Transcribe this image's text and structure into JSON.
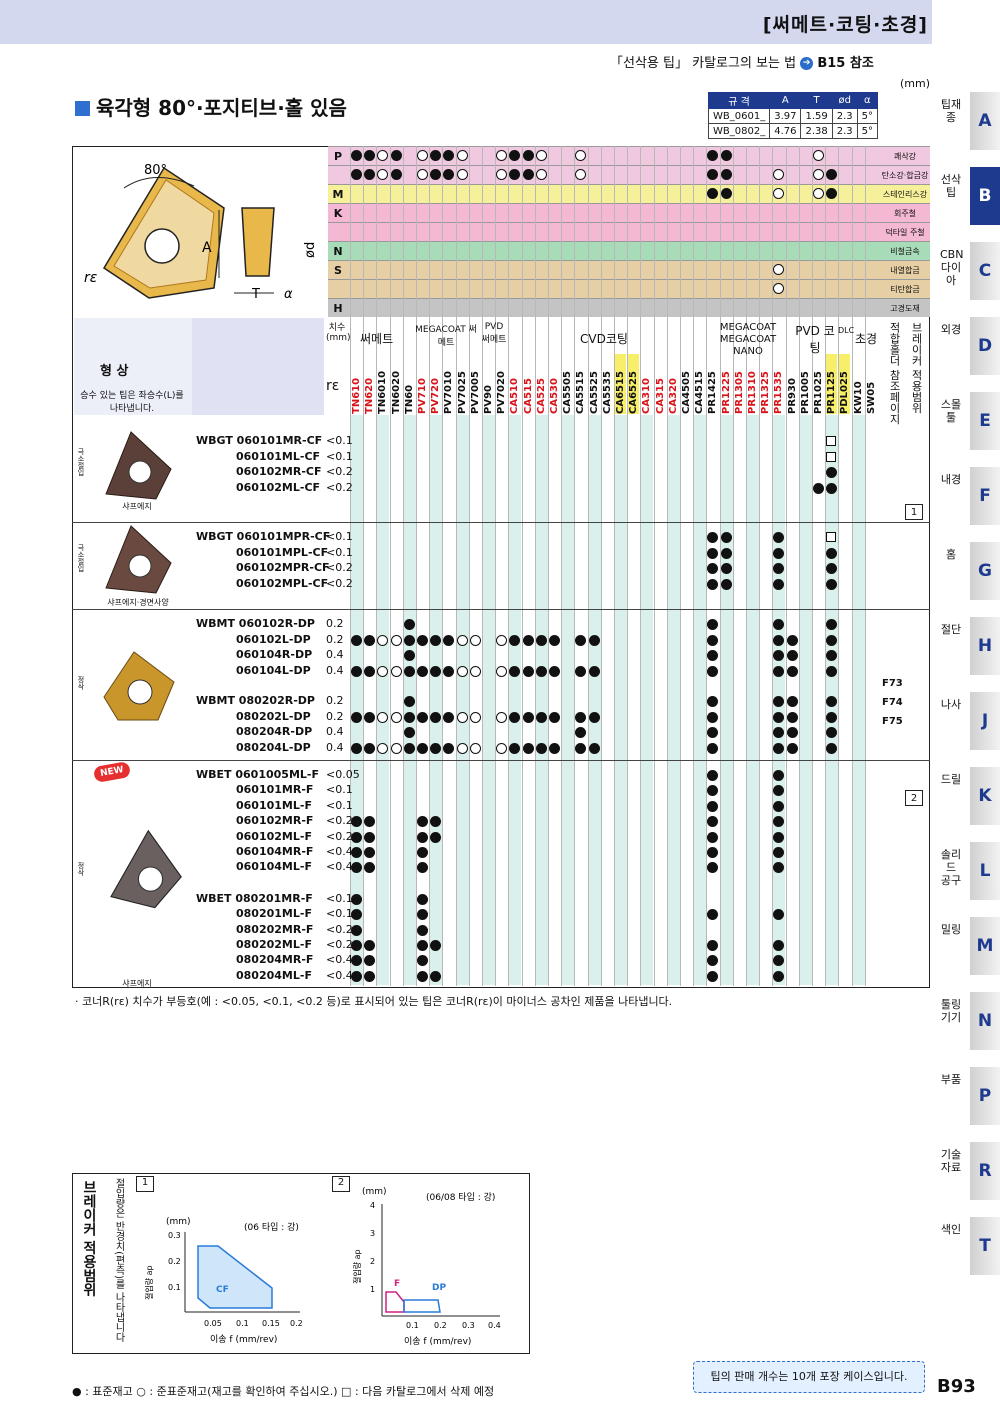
{
  "header": {
    "title": "[써메트·코팅·초경]"
  },
  "reference": {
    "text": "「선삭용 팁」 카탈로그의 보는 법",
    "link": "B15 참조"
  },
  "unit": "(mm)",
  "section_title": "육각형 80°·포지티브·홀 있음",
  "dim_table": {
    "headers": [
      "규 격",
      "A",
      "T",
      "ød",
      "α"
    ],
    "rows": [
      [
        "WB_0601_",
        "3.97",
        "1.59",
        "2.3",
        "5°"
      ],
      [
        "WB_0802_",
        "4.76",
        "2.38",
        "2.3",
        "5°"
      ]
    ]
  },
  "diagram": {
    "angle": "80°",
    "a": "A",
    "t": "T",
    "d": "ød",
    "alpha": "α",
    "re": "rε"
  },
  "work_materials": [
    {
      "code": "P",
      "name": "쾌삭강",
      "color": "#f0c8e0"
    },
    {
      "code": "",
      "name": "탄소강·합금강",
      "color": "#f0c8e0"
    },
    {
      "code": "M",
      "name": "스테인리스강",
      "color": "#f6f09a"
    },
    {
      "code": "K",
      "name": "회주철",
      "color": "#f4b8d4"
    },
    {
      "code": "",
      "name": "덕타일 주철",
      "color": "#f4b8d4"
    },
    {
      "code": "N",
      "name": "비철금속",
      "color": "#a8dcb8"
    },
    {
      "code": "S",
      "name": "내열합금",
      "color": "#e6cfa4"
    },
    {
      "code": "",
      "name": "티탄합금",
      "color": "#e6cfa4"
    },
    {
      "code": "H",
      "name": "고경도재",
      "color": "#c4c4c4"
    }
  ],
  "col_groups": {
    "size": "치수 (mm)",
    "cermet": "써메트",
    "megacoat_cermet": "MEGACOAT 써메트",
    "pvd_cermet": "PVD 써메트",
    "cvd": "CVD코팅",
    "megacoat_nano": "MEGACOAT MEGACOAT NANO",
    "pvd": "PVD 코팅",
    "dlc": "DLC",
    "carbide": "초경",
    "holder": "적합홀더 참조페이지",
    "breaker": "브레이커 적용범위"
  },
  "shape_head": "형 상",
  "spec_head": "규 격",
  "shape_note": "승수 있는 팁은 좌승수(L)를 나타냅니다.",
  "re_head": "rε",
  "grades": [
    "TN610",
    "TN620",
    "TN6010",
    "TN6020",
    "TN60",
    "PV710",
    "PV720",
    "PV7010",
    "PV7025",
    "PV7005",
    "PV90",
    "PV7020",
    "CA510",
    "CA515",
    "CA525",
    "CA530",
    "CA5505",
    "CA5515",
    "CA5525",
    "CA5535",
    "CA6515",
    "CA6525",
    "CA310",
    "CA315",
    "CA320",
    "CA4505",
    "CA4515",
    "PR1425",
    "PR1225",
    "PR1305",
    "PR1310",
    "PR1325",
    "PR1535",
    "PR930",
    "PR1005",
    "PR1025",
    "PR1125",
    "PDL025",
    "KW10",
    "SW05"
  ],
  "groups": [
    {
      "cat": "극소절입",
      "caption": "샤프에지",
      "items": [
        [
          "WBGT 060101MR-CF",
          "<0.1"
        ],
        [
          "060101ML-CF",
          "<0.1"
        ],
        [
          "060102MR-CF",
          "<0.2"
        ],
        [
          "060102ML-CF",
          "<0.2"
        ]
      ]
    },
    {
      "cat": "극소절입",
      "caption": "샤프에지·경면사양",
      "items": [
        [
          "WBGT 060101MPR-CF",
          "<0.1"
        ],
        [
          "060101MPL-CF",
          "<0.1"
        ],
        [
          "060102MPR-CF",
          "<0.2"
        ],
        [
          "060102MPL-CF",
          "<0.2"
        ]
      ]
    },
    {
      "cat": "정삭",
      "caption": "",
      "items": [
        [
          "WBMT 060102R-DP",
          "0.2"
        ],
        [
          "060102L-DP",
          "0.2"
        ],
        [
          "060104R-DP",
          "0.4"
        ],
        [
          "060104L-DP",
          "0.4"
        ],
        [
          "WBMT 080202R-DP",
          "0.2"
        ],
        [
          "080202L-DP",
          "0.2"
        ],
        [
          "080204R-DP",
          "0.4"
        ],
        [
          "080204L-DP",
          "0.4"
        ]
      ]
    },
    {
      "cat": "정삭",
      "caption": "샤프에지",
      "badge": "NEW",
      "items": [
        [
          "WBET 0601005ML-F",
          "<0.05"
        ],
        [
          "060101MR-F",
          "<0.1"
        ],
        [
          "060101ML-F",
          "<0.1"
        ],
        [
          "060102MR-F",
          "<0.2"
        ],
        [
          "060102ML-F",
          "<0.2"
        ],
        [
          "060104MR-F",
          "<0.4"
        ],
        [
          "060104ML-F",
          "<0.4"
        ],
        [
          "WBET 080201MR-F",
          "<0.1"
        ],
        [
          "080201ML-F",
          "<0.1"
        ],
        [
          "080202MR-F",
          "<0.2"
        ],
        [
          "080202ML-F",
          "<0.2"
        ],
        [
          "080204MR-F",
          "<0.4"
        ],
        [
          "080204ML-F",
          "<0.4"
        ]
      ]
    }
  ],
  "holder_pages": [
    "F73",
    "F74",
    "F75"
  ],
  "breaker_refs": [
    "1",
    "2"
  ],
  "note": "· 코너R(rε) 치수가 부등호(예 : <0.05, <0.1, <0.2 등)로 표시되어 있는 팁은 코너R(rε)이 마이너스 공차인 제품을 나타냅니다.",
  "breaker_panel": {
    "title": "브레이커 적용범위",
    "sub": "절입량은 반경치(편측)를 나타냅니다",
    "chart1": {
      "no": "1",
      "unit": "(mm)",
      "type": "(06 타입 : 강)",
      "ylabel": "절입량 ap",
      "xlabel": "이송 f (mm/rev)",
      "label": "CF",
      "xticks": [
        "0.05",
        "0.1",
        "0.15",
        "0.2"
      ],
      "yticks": [
        "0.1",
        "0.2",
        "0.3"
      ]
    },
    "chart2": {
      "no": "2",
      "unit": "(mm)",
      "type": "(06/08 타입 : 강)",
      "ylabel": "절입량 ap",
      "xlabel": "이송 f (mm/rev)",
      "labels": [
        "F",
        "DP"
      ],
      "xticks": [
        "0.1",
        "0.2",
        "0.3",
        "0.4"
      ],
      "yticks": [
        "1",
        "2",
        "3",
        "4"
      ]
    }
  },
  "legend": "● : 표준재고   ○ : 준표준재고(재고를 확인하여 주십시오.)   □ : 다음 카탈로그에서 삭제 예정",
  "pack_note": "팁의 판매 개수는 10개 포장 케이스입니다.",
  "page_number": "B93",
  "side_tabs": [
    {
      "k": "팁재종",
      "l": "A"
    },
    {
      "k": "선삭팁",
      "l": "B",
      "active": true
    },
    {
      "k": "CBN 다이아",
      "l": "C"
    },
    {
      "k": "외경",
      "l": "D"
    },
    {
      "k": "스몰툴",
      "l": "E"
    },
    {
      "k": "내경",
      "l": "F"
    },
    {
      "k": "홈",
      "l": "G"
    },
    {
      "k": "절단",
      "l": "H"
    },
    {
      "k": "나사",
      "l": "J"
    },
    {
      "k": "드릴",
      "l": "K"
    },
    {
      "k": "솔리드 공구",
      "l": "L"
    },
    {
      "k": "밀링",
      "l": "M"
    },
    {
      "k": "툴링 기기",
      "l": "N"
    },
    {
      "k": "부품",
      "l": "P"
    },
    {
      "k": "기술 자료",
      "l": "R"
    },
    {
      "k": "색인",
      "l": "T"
    }
  ]
}
